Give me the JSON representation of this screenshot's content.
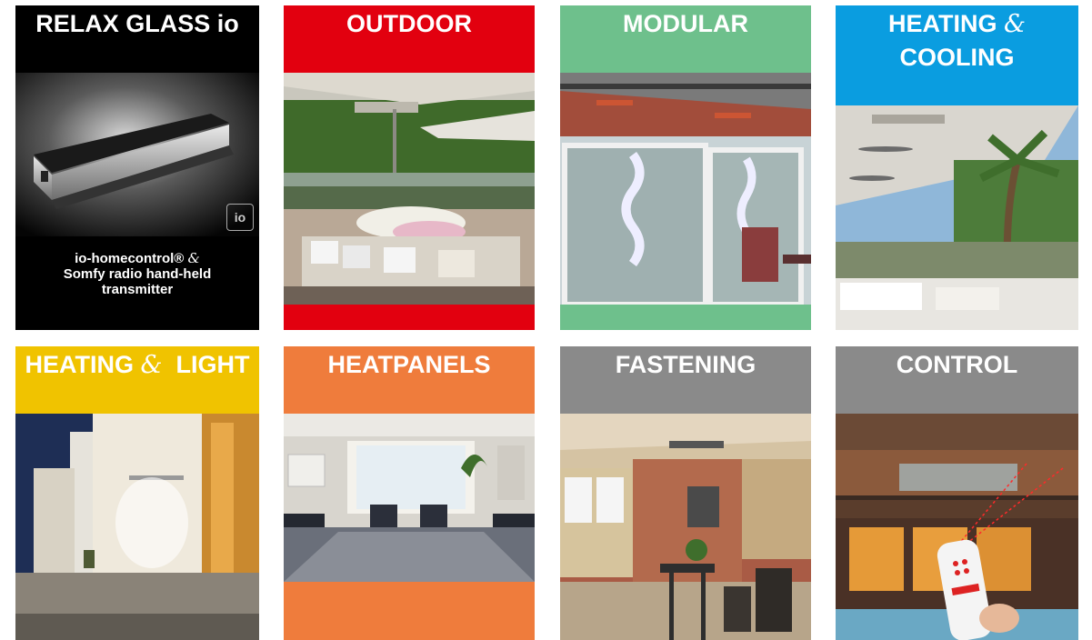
{
  "tiles": [
    {
      "id": "relax-glass-io",
      "title": "RELAX GLASS io",
      "caption_line1": "io-homecontrol®",
      "caption_amp": "&",
      "caption_line2": "Somfy radio hand-held",
      "caption_line3": "transmitter",
      "badge": "io",
      "color": "#000000"
    },
    {
      "id": "outdoor",
      "title": "OUTDOOR",
      "color": "#e2000f"
    },
    {
      "id": "modular",
      "title": "MODULAR",
      "color": "#6ec08c"
    },
    {
      "id": "heating-cooling",
      "title_a": "HEATING",
      "title_amp": "&",
      "title_b": "COOLING",
      "color": "#0a9de0"
    },
    {
      "id": "heating-light",
      "title_a": "HEATING",
      "title_amp": "&",
      "title_b": "LIGHT",
      "color": "#f0c300"
    },
    {
      "id": "heatpanels",
      "title": "HEATPANELS",
      "color": "#ef7c3c"
    },
    {
      "id": "fastening",
      "title": "FASTENING",
      "color": "#8a8a8a"
    },
    {
      "id": "control",
      "title": "CONTROL",
      "color": "#8a8a8a"
    }
  ]
}
